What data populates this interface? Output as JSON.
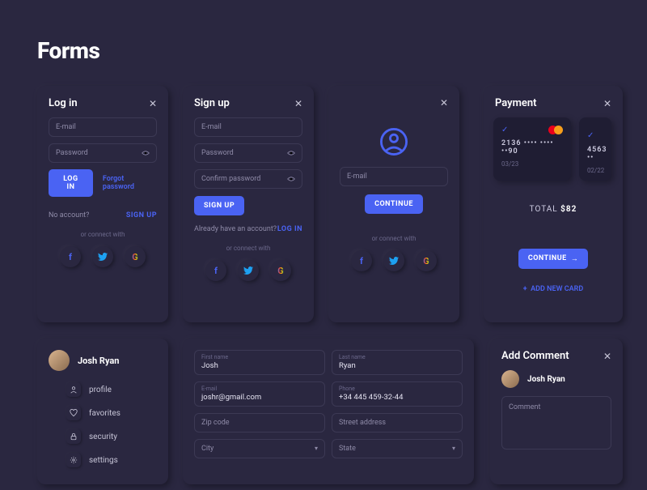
{
  "page_title": "Forms",
  "login": {
    "title": "Log in",
    "email": "E-mail",
    "password": "Password",
    "button": "LOG IN",
    "forgot": "Forgot password",
    "no_account": "No account?",
    "signup_link": "SIGN UP"
  },
  "signup": {
    "title": "Sign up",
    "email": "E-mail",
    "password": "Password",
    "confirm": "Confirm password",
    "button": "SIGN UP",
    "have_account": "Already have an account?",
    "login_link": "LOG IN"
  },
  "continue": {
    "email": "E-mail",
    "button": "CONTINUE"
  },
  "connect_label": "or connect with",
  "payment": {
    "title": "Payment",
    "card1_num": "2136 •••• •••• ••90",
    "card1_exp": "03/23",
    "card2_num": "4563 ••",
    "card2_exp": "02/22",
    "total_label": "TOTAL",
    "total_amount": "$82",
    "continue": "CONTINUE",
    "add_card": "ADD NEW CARD"
  },
  "profile": {
    "name": "Josh Ryan",
    "menu": [
      "profile",
      "favorites",
      "security",
      "settings"
    ]
  },
  "edit": {
    "first_name_label": "First name",
    "first_name": "Josh",
    "last_name_label": "Last name",
    "last_name": "Ryan",
    "email_label": "E-mail",
    "email": "joshr@gmail.com",
    "phone_label": "Phone",
    "phone": "+34 445 459-32-44",
    "zip": "Zip code",
    "street": "Street address",
    "city": "City",
    "state": "State"
  },
  "comment": {
    "title": "Add Comment",
    "name": "Josh Ryan",
    "placeholder": "Comment"
  }
}
